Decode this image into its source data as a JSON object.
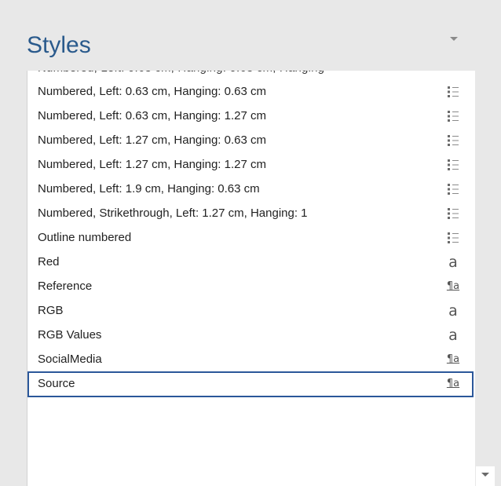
{
  "pane": {
    "title": "Styles"
  },
  "styles": [
    {
      "label": "Numbered, Left:  0.63 cm, Hanging:  0.63 cm",
      "icon": "list-style-icon"
    },
    {
      "label": "Numbered, Left:  0.63 cm, Hanging:  1.27 cm",
      "icon": "list-style-icon"
    },
    {
      "label": "Numbered, Left:  1.27 cm, Hanging:  0.63 cm",
      "icon": "list-style-icon"
    },
    {
      "label": "Numbered, Left:  1.27 cm, Hanging:  1.27 cm",
      "icon": "list-style-icon"
    },
    {
      "label": "Numbered, Left:  1.9 cm, Hanging:  0.63 cm",
      "icon": "list-style-icon"
    },
    {
      "label": "Numbered, Strikethrough, Left:  1.27 cm, Hanging:  1",
      "icon": "list-style-icon"
    },
    {
      "label": "Outline numbered",
      "icon": "list-style-icon"
    },
    {
      "label": "Red",
      "icon": "character-style-icon",
      "glyph": "a"
    },
    {
      "label": "Reference",
      "icon": "linked-style-icon",
      "glyph": "¶a"
    },
    {
      "label": "RGB",
      "icon": "character-style-icon",
      "glyph": "a"
    },
    {
      "label": "RGB Values",
      "icon": "character-style-icon",
      "glyph": "a"
    },
    {
      "label": "SocialMedia",
      "icon": "linked-style-icon",
      "glyph": "¶a"
    },
    {
      "label": "Source",
      "icon": "linked-style-icon",
      "glyph": "¶a",
      "selected": true
    }
  ],
  "colors": {
    "title": "#2a5a8c",
    "selection_border": "#2b579a",
    "pane_background": "#e8e8e8"
  }
}
